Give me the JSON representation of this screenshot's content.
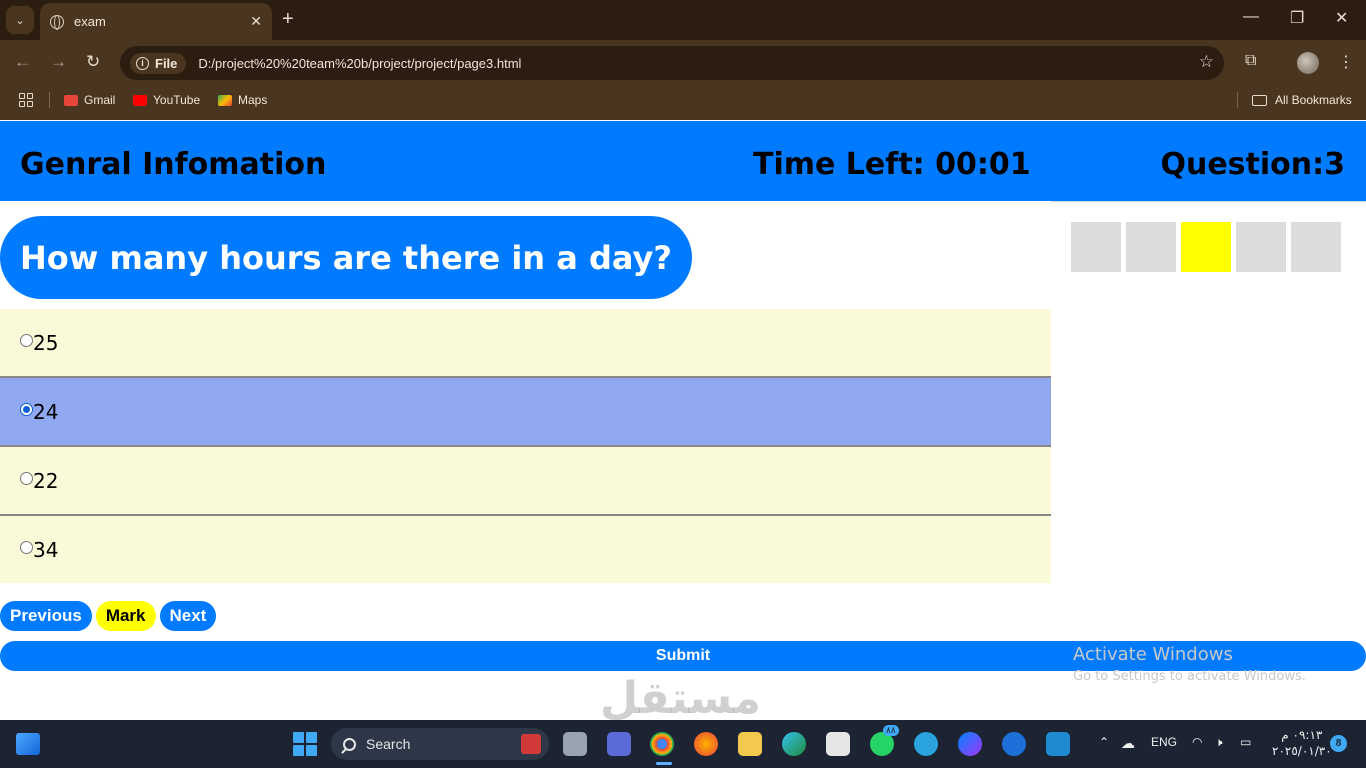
{
  "browser": {
    "tab_title": "exam",
    "address_chip": "File",
    "url": "D:/project%20%20team%20b/project/project/page3.html",
    "bookmarks": [
      "Gmail",
      "YouTube",
      "Maps"
    ],
    "all_bookmarks": "All Bookmarks"
  },
  "header": {
    "subject": "Genral Infomation",
    "time_left": "Time Left: 00:01",
    "question_number": "Question:3"
  },
  "question": {
    "text": "How many hours are there in a day?",
    "options": [
      "25",
      "24",
      "22",
      "34"
    ],
    "selected_index": 1
  },
  "nav": {
    "previous": "Previous",
    "mark": "Mark",
    "next": "Next",
    "submit": "Submit"
  },
  "tracker": {
    "count": 5,
    "current_index": 2
  },
  "activation": {
    "title": "Activate Windows",
    "subtitle": "Go to Settings to activate Windows."
  },
  "watermark": "مستقل",
  "taskbar": {
    "search_label": "Search",
    "language": "ENG",
    "time": "٠٩:١٣ م",
    "date": "٢٠٢٥/٠١/٣٠",
    "notification_count": "8",
    "whatsapp_badge": "٨٨"
  },
  "colors": {
    "primary": "#007bff",
    "mark": "#ffff00",
    "option_bg": "#fafad8",
    "option_selected": "#8fa8ef",
    "tracker_box": "#dcdcdc"
  }
}
